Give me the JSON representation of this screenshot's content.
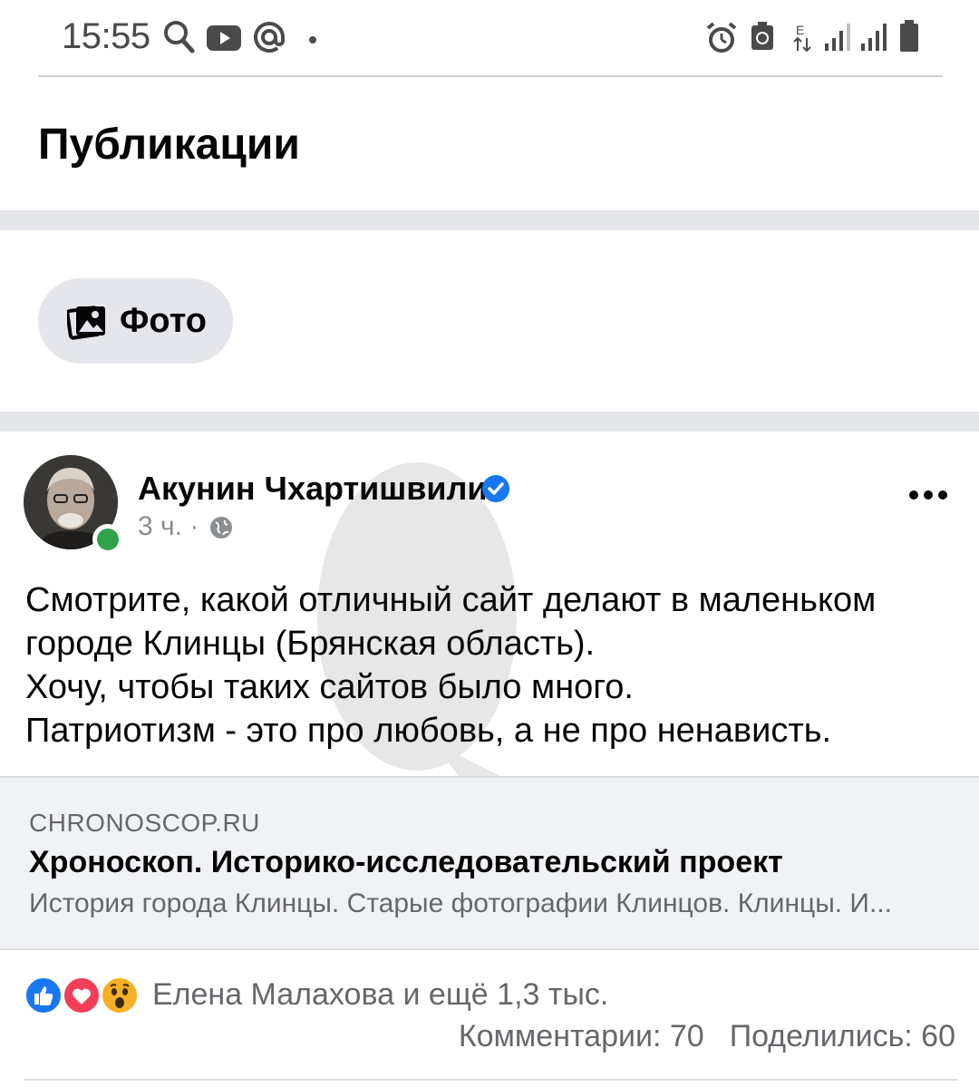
{
  "status_bar": {
    "time": "15:55",
    "left_icons": [
      "search-icon",
      "youtube-icon",
      "at-icon",
      "dot-icon"
    ],
    "right_icons": [
      "alarm-icon",
      "recycle-icon",
      "network-e-icon",
      "signal-icon",
      "signal-icon",
      "battery-icon"
    ]
  },
  "header": {
    "title": "Публикации"
  },
  "filters": {
    "photo_label": "Фото",
    "photo_icon": "photo-icon"
  },
  "post": {
    "author": "Акунин Чхартишвили",
    "verified": true,
    "time": "3 ч.",
    "separator": "·",
    "privacy_icon": "globe-icon",
    "text_lines": [
      "Смотрите, какой отличный сайт делают в маленьком",
      "городе Клинцы (Брянская область).",
      "Хочу, чтобы таких сайтов было много.",
      "Патриотизм - это про любовь, а не про ненависть."
    ],
    "link": {
      "domain": "CHRONOSCOP.RU",
      "title": "Хроноскоп. Историко-исследовательский проект",
      "description": "История города Клинцы. Старые фотографии Клинцов. Клинцы. И..."
    },
    "reactions": {
      "icons": [
        "like-icon",
        "love-icon",
        "wow-icon"
      ],
      "summary": "Елена Малахова и ещё 1,3 тыс.",
      "comments": "Комментарии: 70",
      "shares": "Поделились: 60"
    }
  },
  "colors": {
    "divider": "#e4e6e9",
    "chip_bg": "#e4e6eb",
    "online": "#31a24c",
    "verified": "#1877f2",
    "link_bg": "#f0f2f5",
    "secondary_text": "#65676b"
  }
}
